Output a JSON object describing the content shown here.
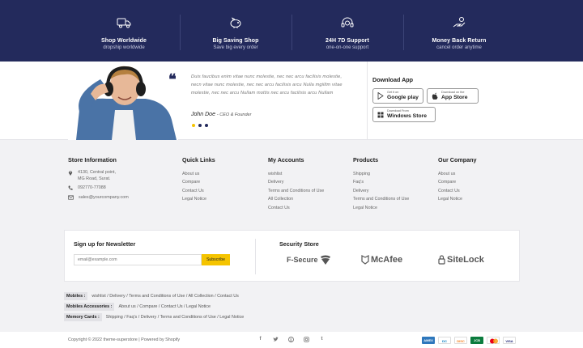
{
  "features": [
    {
      "icon": "truck-icon",
      "title": "Shop Worldwide",
      "subtitle": "dropship worldwide"
    },
    {
      "icon": "piggy-bank-icon",
      "title": "Big Saving Shop",
      "subtitle": "Save big every order"
    },
    {
      "icon": "headset-icon",
      "title": "24H 7D Support",
      "subtitle": "one-on-one support"
    },
    {
      "icon": "money-hand-icon",
      "title": "Money Back Return",
      "subtitle": "cancel order anytime"
    }
  ],
  "testimonial": {
    "text": "Duis faucibus enim vitae nunc molestie, nec nec arcu facilisis molestie, necn vitae nunc molestie, nec nec arcu facilisis arcu Nulla mgiiltm vitae molestie, nec nec arcu Nullam mottis nec arcu facilisis arcu Nullam",
    "author": "John Doe",
    "role": "- CEO & Founder"
  },
  "download_app": {
    "title": "Download App",
    "google_small": "Get it on",
    "google_big": "Google play",
    "apple_small": "Download on the",
    "apple_big": "App Store",
    "windows_small": "Download From",
    "windows_big": "Windows Store"
  },
  "store_info": {
    "title": "Store Information",
    "address_line1": "4130, Central point,",
    "address_line2": "MG Road, Surat.",
    "phone": "092770-77088",
    "email": "sales@yourcompany.com"
  },
  "quick_links": {
    "title": "Quick Links",
    "items": [
      "About us",
      "Compare",
      "Contact Us",
      "Legal Notice"
    ]
  },
  "my_accounts": {
    "title": "My Accounts",
    "items": [
      "wishlist",
      "Delivery",
      "Terms and Conditions of Use",
      "All Collection",
      "Contact Us"
    ]
  },
  "products": {
    "title": "Products",
    "items": [
      "Shipping",
      "Faq's",
      "Delivery",
      "Terms and Conditions of Use",
      "Legal Notice"
    ]
  },
  "our_company": {
    "title": "Our Company",
    "items": [
      "About us",
      "Compare",
      "Contact Us",
      "Legal Notice"
    ]
  },
  "newsletter": {
    "title": "Sign up for Newsletter",
    "placeholder": "email@example.com",
    "button": "Subscribe"
  },
  "security": {
    "title": "Security Store",
    "brands": [
      "F-Secure",
      "McAfee",
      "SiteLock"
    ]
  },
  "taglines": [
    {
      "label": "Mobiles :",
      "links": "wishlist / Delivery / Terms and Conditions of Use / All Collection / Contact Us"
    },
    {
      "label": "Mobiles Accessories :",
      "links": "About us / Compare / Contact Us / Legal Notice"
    },
    {
      "label": "Memory Cards :",
      "links": "Shipping / Faq's / Delivery / Terms and Conditions of Use / Legal Notice"
    }
  ],
  "footer": {
    "copyright": "Copyright © 2022 theme-superstore | Powered by Shopify",
    "socials": [
      "facebook-icon",
      "twitter-icon",
      "pinterest-icon",
      "instagram-icon",
      "tumblr-icon"
    ],
    "payments": [
      "amex",
      "diners",
      "discover",
      "jcb",
      "master",
      "visa"
    ],
    "payment_labels": [
      "AMEX",
      "DC",
      "DISC",
      "JCB",
      "MC",
      "VISA"
    ]
  },
  "colors": {
    "navy": "#232a5c",
    "accent_yellow": "#f5c400",
    "background": "#f2f2f4"
  }
}
